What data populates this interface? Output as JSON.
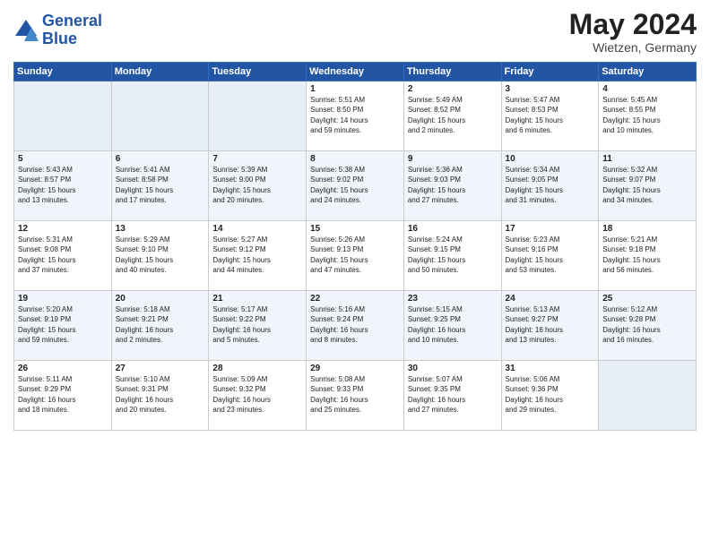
{
  "header": {
    "logo_line1": "General",
    "logo_line2": "Blue",
    "month": "May 2024",
    "location": "Wietzen, Germany"
  },
  "weekdays": [
    "Sunday",
    "Monday",
    "Tuesday",
    "Wednesday",
    "Thursday",
    "Friday",
    "Saturday"
  ],
  "weeks": [
    [
      {
        "day": "",
        "info": ""
      },
      {
        "day": "",
        "info": ""
      },
      {
        "day": "",
        "info": ""
      },
      {
        "day": "1",
        "info": "Sunrise: 5:51 AM\nSunset: 8:50 PM\nDaylight: 14 hours\nand 59 minutes."
      },
      {
        "day": "2",
        "info": "Sunrise: 5:49 AM\nSunset: 8:52 PM\nDaylight: 15 hours\nand 2 minutes."
      },
      {
        "day": "3",
        "info": "Sunrise: 5:47 AM\nSunset: 8:53 PM\nDaylight: 15 hours\nand 6 minutes."
      },
      {
        "day": "4",
        "info": "Sunrise: 5:45 AM\nSunset: 8:55 PM\nDaylight: 15 hours\nand 10 minutes."
      }
    ],
    [
      {
        "day": "5",
        "info": "Sunrise: 5:43 AM\nSunset: 8:57 PM\nDaylight: 15 hours\nand 13 minutes."
      },
      {
        "day": "6",
        "info": "Sunrise: 5:41 AM\nSunset: 8:58 PM\nDaylight: 15 hours\nand 17 minutes."
      },
      {
        "day": "7",
        "info": "Sunrise: 5:39 AM\nSunset: 9:00 PM\nDaylight: 15 hours\nand 20 minutes."
      },
      {
        "day": "8",
        "info": "Sunrise: 5:38 AM\nSunset: 9:02 PM\nDaylight: 15 hours\nand 24 minutes."
      },
      {
        "day": "9",
        "info": "Sunrise: 5:36 AM\nSunset: 9:03 PM\nDaylight: 15 hours\nand 27 minutes."
      },
      {
        "day": "10",
        "info": "Sunrise: 5:34 AM\nSunset: 9:05 PM\nDaylight: 15 hours\nand 31 minutes."
      },
      {
        "day": "11",
        "info": "Sunrise: 5:32 AM\nSunset: 9:07 PM\nDaylight: 15 hours\nand 34 minutes."
      }
    ],
    [
      {
        "day": "12",
        "info": "Sunrise: 5:31 AM\nSunset: 9:08 PM\nDaylight: 15 hours\nand 37 minutes."
      },
      {
        "day": "13",
        "info": "Sunrise: 5:29 AM\nSunset: 9:10 PM\nDaylight: 15 hours\nand 40 minutes."
      },
      {
        "day": "14",
        "info": "Sunrise: 5:27 AM\nSunset: 9:12 PM\nDaylight: 15 hours\nand 44 minutes."
      },
      {
        "day": "15",
        "info": "Sunrise: 5:26 AM\nSunset: 9:13 PM\nDaylight: 15 hours\nand 47 minutes."
      },
      {
        "day": "16",
        "info": "Sunrise: 5:24 AM\nSunset: 9:15 PM\nDaylight: 15 hours\nand 50 minutes."
      },
      {
        "day": "17",
        "info": "Sunrise: 5:23 AM\nSunset: 9:16 PM\nDaylight: 15 hours\nand 53 minutes."
      },
      {
        "day": "18",
        "info": "Sunrise: 5:21 AM\nSunset: 9:18 PM\nDaylight: 15 hours\nand 56 minutes."
      }
    ],
    [
      {
        "day": "19",
        "info": "Sunrise: 5:20 AM\nSunset: 9:19 PM\nDaylight: 15 hours\nand 59 minutes."
      },
      {
        "day": "20",
        "info": "Sunrise: 5:18 AM\nSunset: 9:21 PM\nDaylight: 16 hours\nand 2 minutes."
      },
      {
        "day": "21",
        "info": "Sunrise: 5:17 AM\nSunset: 9:22 PM\nDaylight: 16 hours\nand 5 minutes."
      },
      {
        "day": "22",
        "info": "Sunrise: 5:16 AM\nSunset: 9:24 PM\nDaylight: 16 hours\nand 8 minutes."
      },
      {
        "day": "23",
        "info": "Sunrise: 5:15 AM\nSunset: 9:25 PM\nDaylight: 16 hours\nand 10 minutes."
      },
      {
        "day": "24",
        "info": "Sunrise: 5:13 AM\nSunset: 9:27 PM\nDaylight: 16 hours\nand 13 minutes."
      },
      {
        "day": "25",
        "info": "Sunrise: 5:12 AM\nSunset: 9:28 PM\nDaylight: 16 hours\nand 16 minutes."
      }
    ],
    [
      {
        "day": "26",
        "info": "Sunrise: 5:11 AM\nSunset: 9:29 PM\nDaylight: 16 hours\nand 18 minutes."
      },
      {
        "day": "27",
        "info": "Sunrise: 5:10 AM\nSunset: 9:31 PM\nDaylight: 16 hours\nand 20 minutes."
      },
      {
        "day": "28",
        "info": "Sunrise: 5:09 AM\nSunset: 9:32 PM\nDaylight: 16 hours\nand 23 minutes."
      },
      {
        "day": "29",
        "info": "Sunrise: 5:08 AM\nSunset: 9:33 PM\nDaylight: 16 hours\nand 25 minutes."
      },
      {
        "day": "30",
        "info": "Sunrise: 5:07 AM\nSunset: 9:35 PM\nDaylight: 16 hours\nand 27 minutes."
      },
      {
        "day": "31",
        "info": "Sunrise: 5:06 AM\nSunset: 9:36 PM\nDaylight: 16 hours\nand 29 minutes."
      },
      {
        "day": "",
        "info": ""
      }
    ]
  ]
}
